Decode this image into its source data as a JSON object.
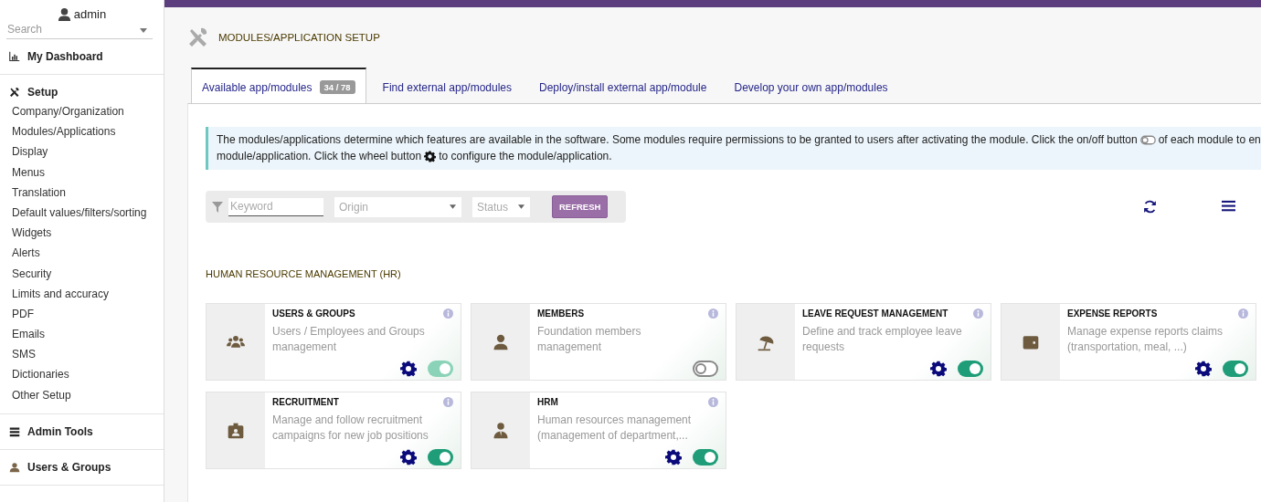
{
  "sidebar": {
    "user": "admin",
    "search": {
      "placeholder": "Search"
    },
    "sections": [
      {
        "title": "My Dashboard"
      },
      {
        "title": "Setup",
        "items": [
          "Company/Organization",
          "Modules/Applications",
          "Display",
          "Menus",
          "Translation",
          "Default values/filters/sorting",
          "Widgets",
          "Alerts",
          "Security",
          "Limits and accuracy",
          "PDF",
          "Emails",
          "SMS",
          "Dictionaries",
          "Other Setup"
        ]
      },
      {
        "title": "Admin Tools"
      },
      {
        "title": "Users & Groups"
      }
    ]
  },
  "page_title": "MODULES/APPLICATION SETUP",
  "tabs": [
    {
      "label": "Available app/modules",
      "badge": "34 / 78",
      "selected": true
    },
    {
      "label": "Find external app/modules",
      "selected": false
    },
    {
      "label": "Deploy/install external app/module",
      "selected": false
    },
    {
      "label": "Develop your own app/modules",
      "selected": false
    }
  ],
  "info": {
    "line1_before": "The modules/applications determine which features are available in the software. Some modules require permissions to be granted to users after activating the module. Click the on/off button",
    "line1_after": "of each module to en",
    "line2_before": "module/application. Click the wheel button",
    "line2_after": "to configure the module/application."
  },
  "filters": {
    "keyword": {
      "placeholder": "Keyword"
    },
    "origin": {
      "placeholder": "Origin"
    },
    "status": {
      "placeholder": "Status"
    },
    "refresh": "REFRESH"
  },
  "group_title": "HUMAN RESOURCE MANAGEMENT (HR)",
  "modules": [
    {
      "title": "USERS & GROUPS",
      "description": "Users / Employees and Groups management",
      "configurable": true,
      "on": true,
      "disabled": true
    },
    {
      "title": "MEMBERS",
      "description": "Foundation members management",
      "configurable": false,
      "on": false,
      "disabled": false
    },
    {
      "title": "LEAVE REQUEST MANAGEMENT",
      "description": "Define and track employee leave requests",
      "configurable": true,
      "on": true,
      "disabled": false
    },
    {
      "title": "EXPENSE REPORTS",
      "description": "Manage expense reports claims (transportation, meal, ...)",
      "configurable": true,
      "on": true,
      "disabled": false
    },
    {
      "title": "RECRUITMENT",
      "description": "Manage and follow recruitment campaigns for new job positions",
      "configurable": true,
      "on": true,
      "disabled": false
    },
    {
      "title": "HRM",
      "description": "Human resources management (management of department,...",
      "configurable": true,
      "on": true,
      "disabled": false
    }
  ]
}
